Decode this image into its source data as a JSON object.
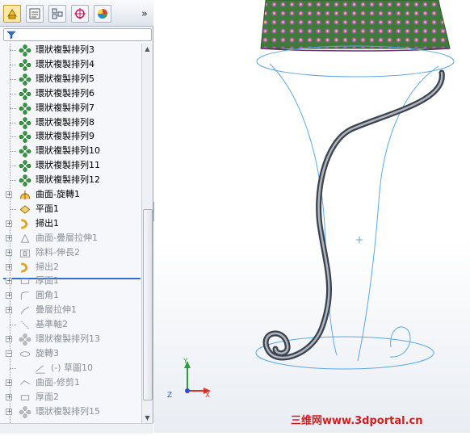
{
  "tabs": [
    {
      "name": "featuremanager",
      "icon": "featuremanager-icon",
      "active": true
    },
    {
      "name": "propertymanager",
      "icon": "propertymanager-icon",
      "active": false
    },
    {
      "name": "configurationmanager",
      "icon": "configurationmanager-icon",
      "active": false
    },
    {
      "name": "dimxpertmanager",
      "icon": "dimxpert-icon",
      "active": false
    },
    {
      "name": "displaymanager",
      "icon": "display-manager-icon",
      "active": false
    }
  ],
  "tree": {
    "items": [
      {
        "label": "環狀複製排列3",
        "icon": "circular-pattern-icon",
        "state": "active"
      },
      {
        "label": "環狀複製排列4",
        "icon": "circular-pattern-icon",
        "state": "active"
      },
      {
        "label": "環狀複製排列5",
        "icon": "circular-pattern-icon",
        "state": "active"
      },
      {
        "label": "環狀複製排列6",
        "icon": "circular-pattern-icon",
        "state": "active"
      },
      {
        "label": "環狀複製排列7",
        "icon": "circular-pattern-icon",
        "state": "active"
      },
      {
        "label": "環狀複製排列8",
        "icon": "circular-pattern-icon",
        "state": "active"
      },
      {
        "label": "環狀複製排列9",
        "icon": "circular-pattern-icon",
        "state": "active"
      },
      {
        "label": "環狀複製排列10",
        "icon": "circular-pattern-icon",
        "state": "active"
      },
      {
        "label": "環狀複製排列11",
        "icon": "circular-pattern-icon",
        "state": "active"
      },
      {
        "label": "環狀複製排列12",
        "icon": "circular-pattern-icon",
        "state": "active"
      },
      {
        "label": "曲面-旋轉1",
        "icon": "surface-revolve-icon",
        "state": "active"
      },
      {
        "label": "平面1",
        "icon": "plane-icon",
        "state": "active"
      },
      {
        "label": "掃出1",
        "icon": "sweep-icon",
        "state": "active"
      },
      {
        "label": "曲面-疊層拉伸1",
        "icon": "surface-loft-icon",
        "state": "suppressed"
      },
      {
        "label": "除料-伸長2",
        "icon": "cut-extrude-icon",
        "state": "suppressed"
      },
      {
        "label": "掃出2",
        "icon": "sweep-icon",
        "state": "suppressed"
      },
      {
        "label": "厚面1",
        "icon": "thicken-icon",
        "state": "suppressed"
      },
      {
        "label": "圓角1",
        "icon": "fillet-icon",
        "state": "suppressed"
      },
      {
        "label": "疊層拉伸1",
        "icon": "loft-icon",
        "state": "suppressed"
      },
      {
        "label": "基準軸2",
        "icon": "axis-icon",
        "state": "suppressed"
      },
      {
        "label": "環狀複製排列13",
        "icon": "circular-pattern-icon",
        "state": "suppressed"
      },
      {
        "label": "旋轉3",
        "icon": "revolve-icon",
        "state": "suppressed"
      },
      {
        "label": "(-) 草圖10",
        "icon": "sketch-icon",
        "state": "suppressed"
      },
      {
        "label": "曲面-修剪1",
        "icon": "surface-trim-icon",
        "state": "suppressed"
      },
      {
        "label": "厚面2",
        "icon": "thicken-icon",
        "state": "suppressed"
      },
      {
        "label": "環狀複製排列15",
        "icon": "circular-pattern-icon",
        "state": "suppressed"
      }
    ]
  },
  "triad": {
    "x": "X",
    "y": "Y",
    "z": "Z"
  },
  "watermark": "三维网www.3dportal.cn",
  "colors": {
    "accent": "#2f6fd0",
    "pattern_icon": "#2e9d3a",
    "feature_icon": "#e7b12a",
    "sketch_curve": "#5aa9e6",
    "model_metal": "#6b7380",
    "watermark": "#d21d1d"
  }
}
